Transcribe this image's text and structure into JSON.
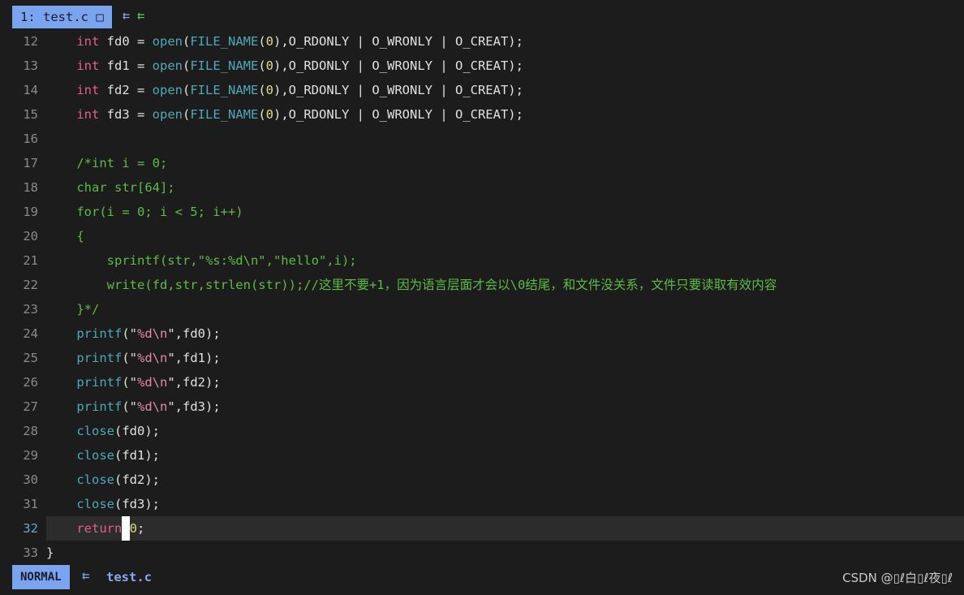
{
  "tabline": {
    "active_tab": "1: test.c □",
    "arrows": "⇇ ",
    "arrows_green": "⇇"
  },
  "editor": {
    "lines": [
      {
        "n": "12",
        "t": [
          [
            "",
            "    "
          ],
          [
            "kw",
            "int"
          ],
          [
            "pl",
            " fd0 = "
          ],
          [
            "fn",
            "open"
          ],
          [
            "pl",
            "("
          ],
          [
            "mac",
            "FILE_NAME"
          ],
          [
            "pl",
            "("
          ],
          [
            "num",
            "0"
          ],
          [
            "pl",
            "),O_RDONLY | O_WRONLY | O_CREAT);"
          ]
        ]
      },
      {
        "n": "13",
        "t": [
          [
            "",
            "    "
          ],
          [
            "kw",
            "int"
          ],
          [
            "pl",
            " fd1 = "
          ],
          [
            "fn",
            "open"
          ],
          [
            "pl",
            "("
          ],
          [
            "mac",
            "FILE_NAME"
          ],
          [
            "pl",
            "("
          ],
          [
            "num",
            "0"
          ],
          [
            "pl",
            "),O_RDONLY | O_WRONLY | O_CREAT);"
          ]
        ]
      },
      {
        "n": "14",
        "t": [
          [
            "",
            "    "
          ],
          [
            "kw",
            "int"
          ],
          [
            "pl",
            " fd2 = "
          ],
          [
            "fn",
            "open"
          ],
          [
            "pl",
            "("
          ],
          [
            "mac",
            "FILE_NAME"
          ],
          [
            "pl",
            "("
          ],
          [
            "num",
            "0"
          ],
          [
            "pl",
            "),O_RDONLY | O_WRONLY | O_CREAT);"
          ]
        ]
      },
      {
        "n": "15",
        "t": [
          [
            "",
            "    "
          ],
          [
            "kw",
            "int"
          ],
          [
            "pl",
            " fd3 = "
          ],
          [
            "fn",
            "open"
          ],
          [
            "pl",
            "("
          ],
          [
            "mac",
            "FILE_NAME"
          ],
          [
            "pl",
            "("
          ],
          [
            "num",
            "0"
          ],
          [
            "pl",
            "),O_RDONLY | O_WRONLY | O_CREAT);"
          ]
        ]
      },
      {
        "n": "16",
        "t": []
      },
      {
        "n": "17",
        "t": [
          [
            "cm",
            "    /*int i = 0;"
          ]
        ]
      },
      {
        "n": "18",
        "t": [
          [
            "cm",
            "    char str[64];"
          ]
        ]
      },
      {
        "n": "19",
        "t": [
          [
            "cm",
            "    for(i = 0; i < 5; i++)"
          ]
        ]
      },
      {
        "n": "20",
        "t": [
          [
            "cm",
            "    {"
          ]
        ]
      },
      {
        "n": "21",
        "t": [
          [
            "cm",
            "        sprintf(str,\"%s:%d\\n\",\"hello\",i);"
          ]
        ]
      },
      {
        "n": "22",
        "t": [
          [
            "cm",
            "        write(fd,str,strlen(str));//这里不要+1，因为语言层面才会以\\0结尾，和文件没关系，文件只要读取有效内容"
          ]
        ]
      },
      {
        "n": "23",
        "t": [
          [
            "cm",
            "    }*/"
          ]
        ]
      },
      {
        "n": "24",
        "t": [
          [
            "",
            "    "
          ],
          [
            "fn",
            "printf"
          ],
          [
            "pl",
            "(\""
          ],
          [
            "str",
            "%d\\n"
          ],
          [
            "pl",
            "\",fd0);"
          ]
        ]
      },
      {
        "n": "25",
        "t": [
          [
            "",
            "    "
          ],
          [
            "fn",
            "printf"
          ],
          [
            "pl",
            "(\""
          ],
          [
            "str",
            "%d\\n"
          ],
          [
            "pl",
            "\",fd1);"
          ]
        ]
      },
      {
        "n": "26",
        "t": [
          [
            "",
            "    "
          ],
          [
            "fn",
            "printf"
          ],
          [
            "pl",
            "(\""
          ],
          [
            "str",
            "%d\\n"
          ],
          [
            "pl",
            "\",fd2);"
          ]
        ]
      },
      {
        "n": "27",
        "t": [
          [
            "",
            "    "
          ],
          [
            "fn",
            "printf"
          ],
          [
            "pl",
            "(\""
          ],
          [
            "str",
            "%d\\n"
          ],
          [
            "pl",
            "\",fd3);"
          ]
        ]
      },
      {
        "n": "28",
        "t": [
          [
            "",
            "    "
          ],
          [
            "fn",
            "close"
          ],
          [
            "pl",
            "(fd0);"
          ]
        ]
      },
      {
        "n": "29",
        "t": [
          [
            "",
            "    "
          ],
          [
            "fn",
            "close"
          ],
          [
            "pl",
            "(fd1);"
          ]
        ]
      },
      {
        "n": "30",
        "t": [
          [
            "",
            "    "
          ],
          [
            "fn",
            "close"
          ],
          [
            "pl",
            "(fd2);"
          ]
        ]
      },
      {
        "n": "31",
        "t": [
          [
            "",
            "    "
          ],
          [
            "fn",
            "close"
          ],
          [
            "pl",
            "(fd3);"
          ]
        ]
      },
      {
        "n": "32",
        "cur": true,
        "t": [
          [
            "",
            "    "
          ],
          [
            "kw",
            "return"
          ],
          [
            "cursor",
            " "
          ],
          [
            "num",
            "0"
          ],
          [
            "pl",
            ";"
          ]
        ]
      },
      {
        "n": "33",
        "t": [
          [
            "pl",
            "}"
          ]
        ]
      }
    ]
  },
  "statusline": {
    "mode": "NORMAL",
    "arrow": "⇇",
    "filename": "test.c"
  },
  "watermark": "CSDN @▯ℓ白▯ℓ夜▯ℓ",
  "colors": {
    "accent": "#7aa4ee",
    "keyword": "#e0608a",
    "function": "#4fa8b9",
    "comment": "#5ebb46",
    "number": "#dddd88",
    "string": "#e48aa8"
  }
}
